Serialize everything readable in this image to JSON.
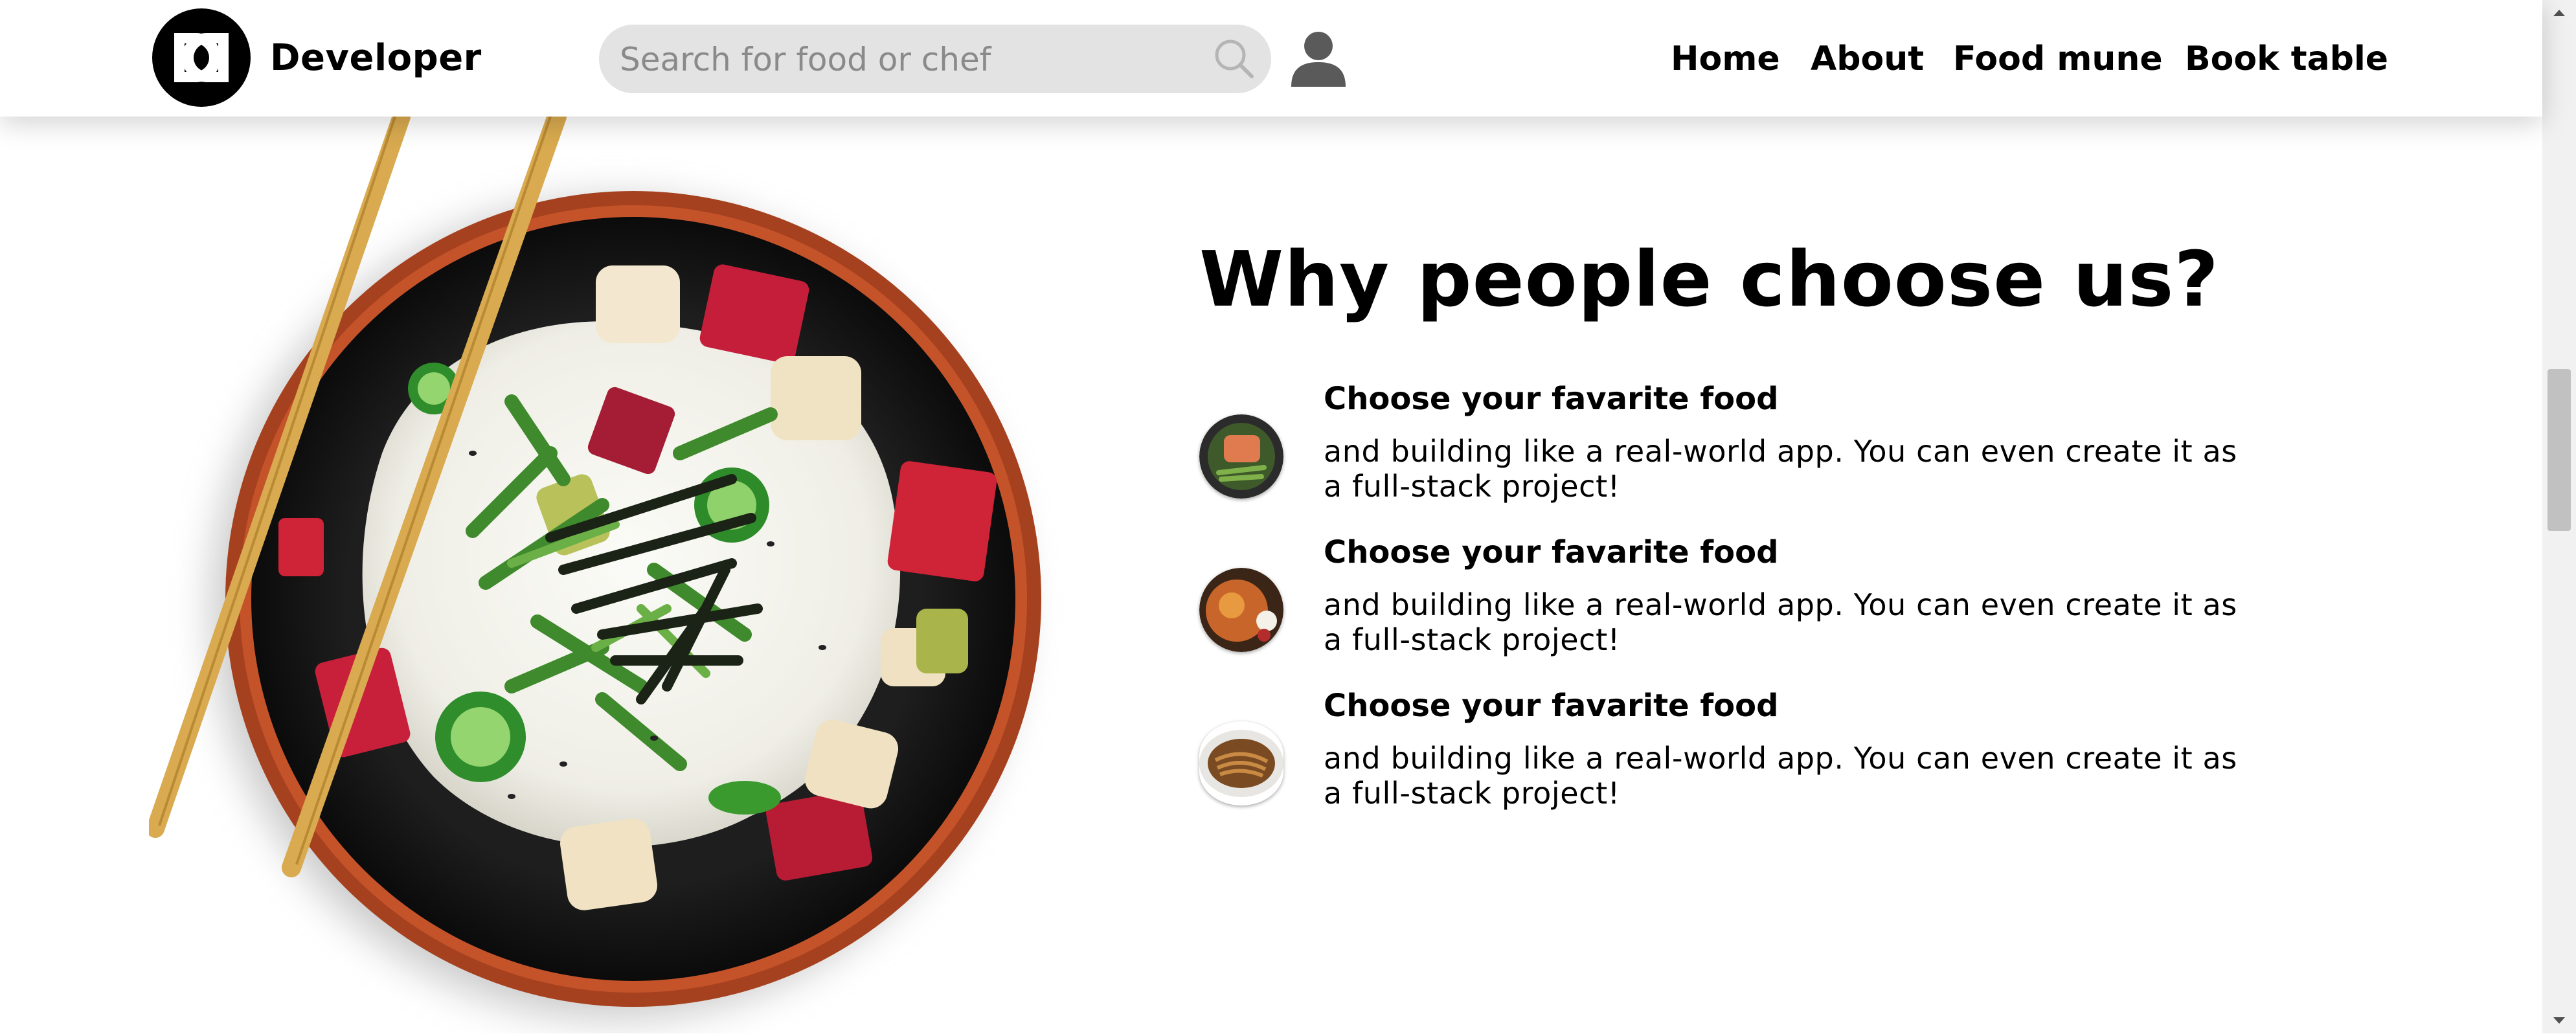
{
  "header": {
    "brand": "Developer",
    "search": {
      "placeholder": "Search for food or chef",
      "value": ""
    },
    "nav": [
      "Home",
      "About",
      "Food mune",
      "Book table"
    ]
  },
  "icons": {
    "logo": "dd-logo-icon",
    "search": "search-icon",
    "user": "user-icon",
    "scroll_up": "scroll-up-arrow-icon",
    "scroll_down": "scroll-down-arrow-icon"
  },
  "main": {
    "heading": "Why people choose us?",
    "features": [
      {
        "title": "Choose your favarite food",
        "text": "and building like a real-world app. You can even create it as a full-stack project!",
        "thumb": "salmon-dish"
      },
      {
        "title": "Choose your favarite food",
        "text": "and building like a real-world app. You can even create it as a full-stack project!",
        "thumb": "curry-dish"
      },
      {
        "title": "Choose your favarite food",
        "text": "and building like a real-world app. You can even create it as a full-stack project!",
        "thumb": "noodle-dish"
      }
    ]
  },
  "colors": {
    "text": "#000000",
    "search_bg": "#e3e3e3",
    "header_bg": "#ffffff",
    "bowl_rim": "#a0401f",
    "chopsticks": "#d9aa4f"
  }
}
